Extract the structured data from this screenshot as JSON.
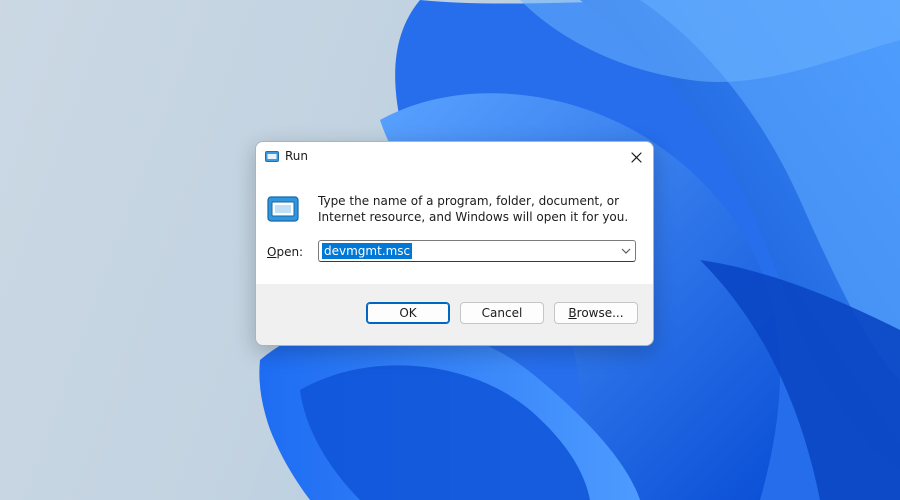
{
  "window": {
    "title": "Run",
    "close_glyph": "✕"
  },
  "dialog": {
    "description": "Type the name of a program, folder, document, or Internet resource, and Windows will open it for you.",
    "open_label_mnemonic": "O",
    "open_label_rest": "pen:",
    "open_value": "devmgmt.msc"
  },
  "buttons": {
    "ok": "OK",
    "cancel": "Cancel",
    "browse_mnemonic": "B",
    "browse_rest": "rowse..."
  },
  "icons": {
    "title": "run-icon",
    "main": "run-icon",
    "close": "close-icon",
    "dropdown": "chevron-down-icon"
  },
  "colors": {
    "accent": "#0067c0",
    "selection": "#0078d7",
    "wallpaper_blue": "#1565e8"
  }
}
